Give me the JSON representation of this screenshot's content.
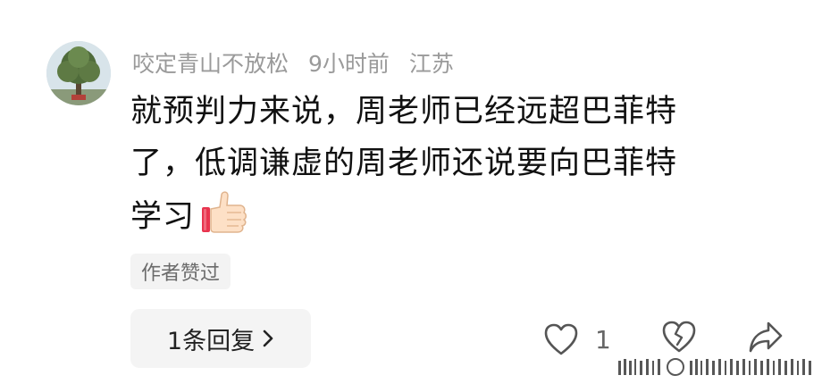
{
  "comment": {
    "username": "咬定青山不放松",
    "time": "9小时前",
    "location": "江苏",
    "text_line1": "就预判力来说，周老师已经远超巴菲特",
    "text_line2": "了，低调谦虚的周老师还说要向巴菲特",
    "text_line3": "学习",
    "emoji": "thumbs-up",
    "author_liked_badge": "作者赞过"
  },
  "actions": {
    "replies_label": "1条回复",
    "like_count": "1"
  },
  "icons": {
    "like": "heart-icon",
    "dislike": "broken-heart-icon",
    "share": "share-arrow-icon",
    "chevron": "chevron-right-icon"
  }
}
